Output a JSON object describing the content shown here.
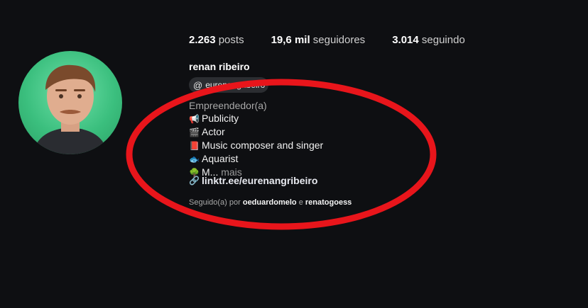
{
  "stats": [
    {
      "value": "2.263",
      "label": "posts"
    },
    {
      "value": "19,6 mil",
      "label": "seguidores"
    },
    {
      "value": "3.014",
      "label": "seguindo"
    }
  ],
  "profile": {
    "name": "renan ribeiro",
    "threads_handle": "eurenangribeiro",
    "category": "Empreendedor(a)",
    "bio": [
      {
        "emoji": "📢",
        "text": "Publicity"
      },
      {
        "emoji": "🎬",
        "text": "Actor"
      },
      {
        "emoji": "📕",
        "text": "Music composer and singer"
      },
      {
        "emoji": "🐟",
        "text": "Aquarist"
      },
      {
        "emoji": "🌳",
        "text": "M..."
      }
    ],
    "more_label": "mais",
    "link": "linktr.ee/eurenangribeiro",
    "followed_prefix": "Seguido(a) por",
    "followed_by_1": "oeduardomelo",
    "followed_join": "e",
    "followed_by_2": "renatogoess"
  },
  "colors": {
    "background": "#0e0f12",
    "annotation_circle": "#e8151b",
    "avatar_background": "#3bbf7e"
  }
}
